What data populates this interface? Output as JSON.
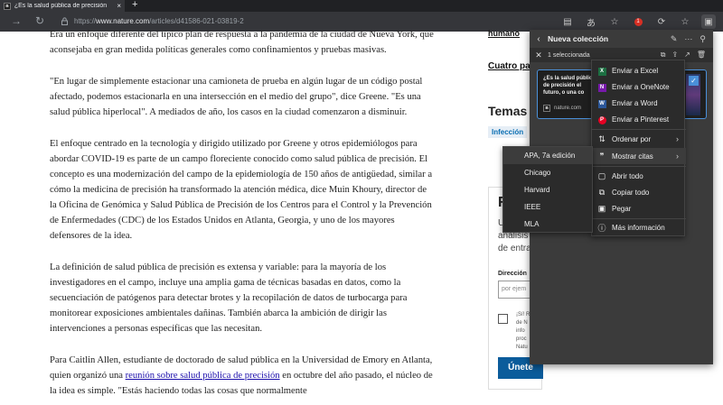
{
  "browser": {
    "tab_title": "¿Es la salud pública de precisión",
    "tab_close": "×",
    "new_tab": "+",
    "url_prefix": "https://",
    "url_host": "www.nature.com",
    "url_path": "/articles/d41586-021-03819-2",
    "badge_count": "1",
    "icons": [
      "reader-icon",
      "translate-icon",
      "favorite-icon",
      "extension-icon",
      "refresh-extension-icon",
      "favorites-bar-icon",
      "collections-icon"
    ]
  },
  "article": {
    "paragraphs": [
      "Era un enfoque diferente del típico plan de respuesta a la pandemia de la ciudad de Nueva York, que aconsejaba en gran medida políticas generales como confinamientos y pruebas masivas.",
      "\"En lugar de simplemente estacionar una camioneta de prueba en algún lugar de un código postal afectado, podemos estacionarla en una intersección en el medio del grupo\", dice Greene. \"Es una salud pública hiperlocal\". A mediados de año, los casos en la ciudad comenzaron a disminuir.",
      "El enfoque centrado en la tecnología y dirigido utilizado por Greene y otros epidemiólogos para abordar COVID-19 es parte de un campo floreciente conocido como salud pública de precisión. El concepto es una modernización del campo de la epidemiología de 150 años de antigüedad, similar a cómo la medicina de precisión ha transformado la atención médica, dice Muin Khoury, director de la Oficina de Genómica y Salud Pública de Precisión de los Centros para el Control y la Prevención de Enfermedades (CDC) de los Estados Unidos en Atlanta, Georgia, y uno de los mayores defensores de la idea.",
      "La definición de salud pública de precisión es extensa y variable: para la mayoría de los investigadores en el campo, incluye una amplia gama de técnicas basadas en datos, como la secuenciación de patógenos para detectar brotes y la recopilación de datos de turbocarga para monitorear exposiciones ambientales dañinas. También abarca la ambición de dirigir las intervenciones a personas específicas que las necesitan."
    ],
    "last_paragraph": {
      "before": "Para Caitlin Allen, estudiante de doctorado de salud pública en la Universidad de Emory en Atlanta, quien organizó una ",
      "link": "reunión sobre salud pública de precisión",
      "after": " en octubre del año pasado, el núcleo de la idea es simple. \"Estás haciendo todas las cosas que normalmente"
    }
  },
  "sidebar": {
    "link1": "humano",
    "link2": "Cuatro pas",
    "heading": "Temas",
    "tag": "Infección"
  },
  "signup": {
    "title": "R",
    "line1": "U",
    "line2": "análisis",
    "line3": "de entra",
    "email_label": "Dirección",
    "email_placeholder": "por ejem",
    "fine1": "¡Sí! R",
    "fine2": "de N",
    "fine3": "info",
    "fine4": "proc",
    "fine5": "Natu",
    "join_label": "Únete"
  },
  "collections": {
    "title": "Nueva colección",
    "selected_text": "1 seleccionada",
    "card_title": "¿Es la salud pública de precisión el futuro, o una co",
    "card_source": "nature.com",
    "card_favicon": "n"
  },
  "context_menu": {
    "items": [
      {
        "label": "Enviar a Excel",
        "icon": "X"
      },
      {
        "label": "Enviar a OneNote",
        "icon": "N"
      },
      {
        "label": "Enviar a Word",
        "icon": "W"
      },
      {
        "label": "Enviar a Pinterest",
        "icon": "P"
      },
      {
        "label": "Ordenar por",
        "icon": "⇅"
      },
      {
        "label": "Mostrar citas",
        "icon": "99"
      },
      {
        "label": "Abrir todo",
        "icon": "▢"
      },
      {
        "label": "Copiar todo",
        "icon": "⧉"
      },
      {
        "label": "Pegar",
        "icon": "📋"
      },
      {
        "label": "Más información",
        "icon": "ⓘ"
      }
    ],
    "submenu_arrow": "›"
  },
  "citations_submenu": {
    "items": [
      "APA, 7a edición",
      "Chicago",
      "Harvard",
      "IEEE",
      "MLA"
    ]
  }
}
